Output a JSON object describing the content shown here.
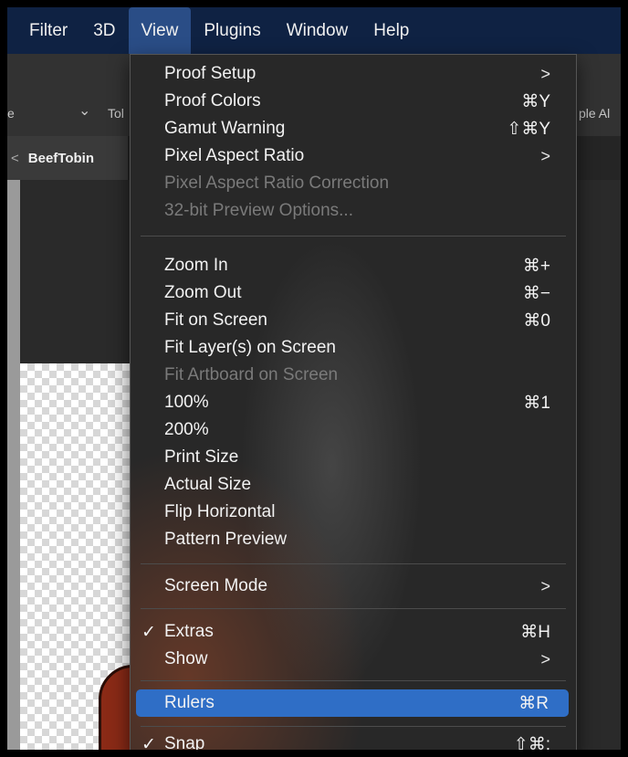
{
  "menubar": {
    "items": [
      {
        "label": "Filter"
      },
      {
        "label": "3D"
      },
      {
        "label": "View"
      },
      {
        "label": "Plugins"
      },
      {
        "label": "Window"
      },
      {
        "label": "Help"
      }
    ]
  },
  "options_bar": {
    "left_fragment": "e",
    "dropdown_chevron": "⌄",
    "tool_fragment": "Tol",
    "right_fragment": "ple Al"
  },
  "tab": {
    "chevron": "<",
    "title": "BeefTobin"
  },
  "view_menu": {
    "items": [
      {
        "label": "Proof Setup",
        "shortcut": "",
        "submenu": ">",
        "check": ""
      },
      {
        "label": "Proof Colors",
        "shortcut": "⌘Y",
        "check": ""
      },
      {
        "label": "Gamut Warning",
        "shortcut": "⇧⌘Y",
        "check": ""
      },
      {
        "label": "Pixel Aspect Ratio",
        "shortcut": "",
        "submenu": ">",
        "check": ""
      },
      {
        "label": "Pixel Aspect Ratio Correction",
        "shortcut": "",
        "check": ""
      },
      {
        "label": "32-bit Preview Options...",
        "shortcut": "",
        "check": ""
      },
      {
        "label": "Zoom In",
        "shortcut": "⌘+",
        "check": ""
      },
      {
        "label": "Zoom Out",
        "shortcut": "⌘−",
        "check": ""
      },
      {
        "label": "Fit on Screen",
        "shortcut": "⌘0",
        "check": ""
      },
      {
        "label": "Fit Layer(s) on Screen",
        "shortcut": "",
        "check": ""
      },
      {
        "label": "Fit Artboard on Screen",
        "shortcut": "",
        "check": ""
      },
      {
        "label": "100%",
        "shortcut": "⌘1",
        "check": ""
      },
      {
        "label": "200%",
        "shortcut": "",
        "check": ""
      },
      {
        "label": "Print Size",
        "shortcut": "",
        "check": ""
      },
      {
        "label": "Actual Size",
        "shortcut": "",
        "check": ""
      },
      {
        "label": "Flip Horizontal",
        "shortcut": "",
        "check": ""
      },
      {
        "label": "Pattern Preview",
        "shortcut": "",
        "check": ""
      },
      {
        "label": "Screen Mode",
        "shortcut": "",
        "submenu": ">",
        "check": ""
      },
      {
        "label": "Extras",
        "shortcut": "⌘H",
        "check": "✓"
      },
      {
        "label": "Show",
        "shortcut": "",
        "submenu": ">",
        "check": ""
      },
      {
        "label": "Rulers",
        "shortcut": "⌘R",
        "check": ""
      },
      {
        "label": "Snap",
        "shortcut": "⇧⌘;",
        "check": "✓"
      }
    ]
  },
  "colors": {
    "menubar_bg": "#0f2243",
    "highlight": "#2f6ec6",
    "menu_bg": "#282828",
    "disabled_text": "#7a7a7a"
  }
}
